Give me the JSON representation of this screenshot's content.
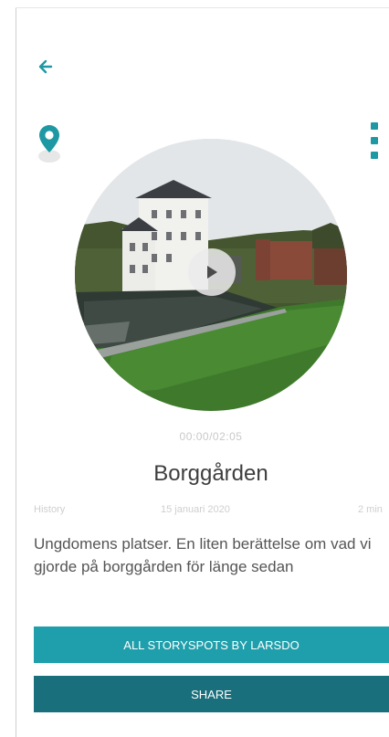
{
  "icons": {
    "back": "arrow-left-icon",
    "location": "location-pin-icon",
    "menu": "more-vertical-icon",
    "play": "play-icon"
  },
  "colors": {
    "accent": "#1f9fab",
    "accent_dark": "#196f7c"
  },
  "player": {
    "timecode": "00:00/02:05"
  },
  "story": {
    "title": "Borggården",
    "category": "History",
    "date": "15 januari 2020",
    "duration": "2 min",
    "description": "Ungdomens platser. En liten berättelse om vad vi gjorde på borggården för länge sedan"
  },
  "actions": {
    "all_storyspots_label": "ALL STORYSPOTS BY LARSDO",
    "share_label": "SHARE"
  }
}
